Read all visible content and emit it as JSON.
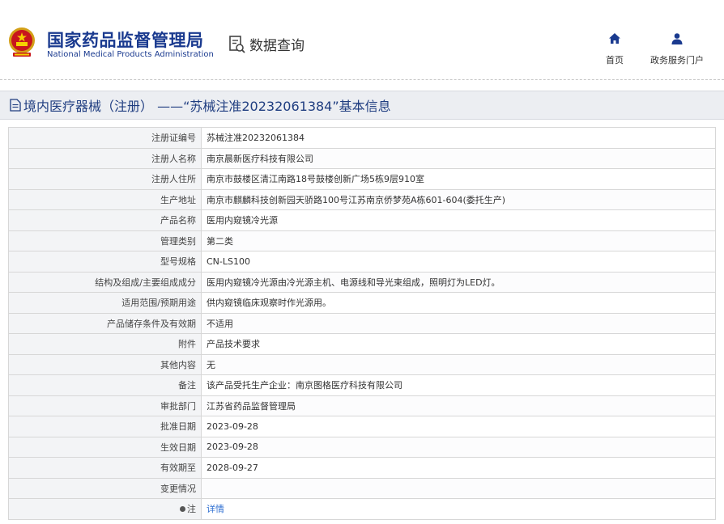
{
  "header": {
    "brand_cn": "国家药品监督管理局",
    "brand_en": "National Medical Products Administration",
    "data_query": "数据查询",
    "nav": [
      {
        "label": "首页",
        "icon": "home-icon"
      },
      {
        "label": "政务服务门户",
        "icon": "user-icon"
      }
    ]
  },
  "title": "境内医疗器械（注册） ——“苏械注准20232061384”基本信息",
  "rows": [
    {
      "label": "注册证编号",
      "value": "苏械注准20232061384"
    },
    {
      "label": "注册人名称",
      "value": "南京晨新医疗科技有限公司"
    },
    {
      "label": "注册人住所",
      "value": "南京市鼓楼区清江南路18号鼓楼创新广场5栋9层910室"
    },
    {
      "label": "生产地址",
      "value": "南京市麒麟科技创新园天骄路100号江苏南京侨梦苑A栋601-604(委托生产)"
    },
    {
      "label": "产品名称",
      "value": "医用内窥镜冷光源"
    },
    {
      "label": "管理类别",
      "value": "第二类"
    },
    {
      "label": "型号规格",
      "value": "CN-LS100"
    },
    {
      "label": "结构及组成/主要组成成分",
      "value": "医用内窥镜冷光源由冷光源主机、电源线和导光束组成，照明灯为LED灯。"
    },
    {
      "label": "适用范围/预期用途",
      "value": "供内窥镜临床观察时作光源用。"
    },
    {
      "label": "产品储存条件及有效期",
      "value": "不适用"
    },
    {
      "label": "附件",
      "value": "产品技术要求"
    },
    {
      "label": "其他内容",
      "value": "无"
    },
    {
      "label": "备注",
      "value": "该产品受托生产企业：南京图格医疗科技有限公司"
    },
    {
      "label": "审批部门",
      "value": "江苏省药品监督管理局"
    },
    {
      "label": "批准日期",
      "value": "2023-09-28"
    },
    {
      "label": "生效日期",
      "value": "2023-09-28"
    },
    {
      "label": "有效期至",
      "value": "2028-09-27"
    },
    {
      "label": "变更情况",
      "value": ""
    },
    {
      "label": "注",
      "value": "详情"
    }
  ],
  "colors": {
    "brand_blue": "#1a3a8f",
    "title_blue": "#1f3d80",
    "link_blue": "#2f6fd1"
  }
}
